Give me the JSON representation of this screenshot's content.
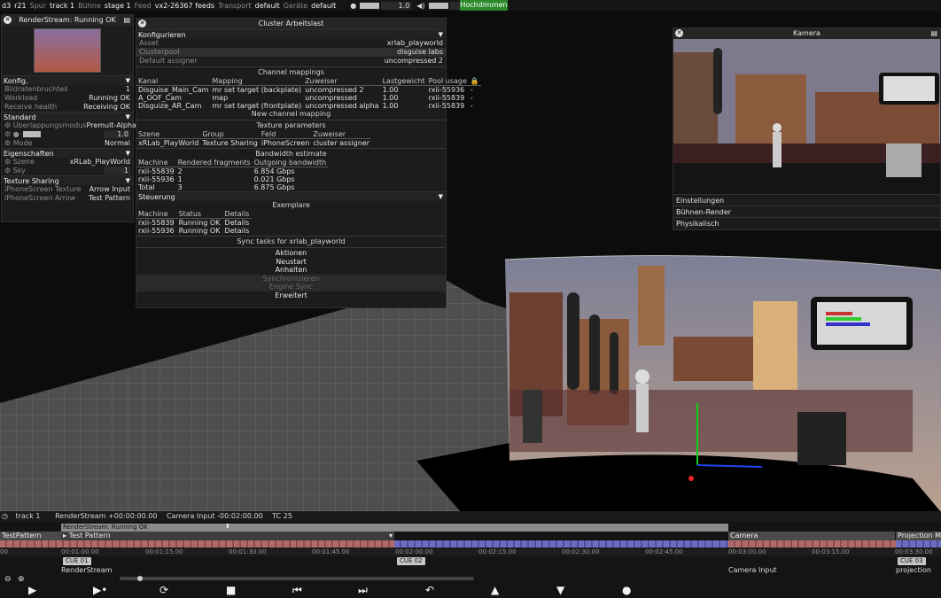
{
  "topbar": {
    "app": "d3",
    "ver": "r21",
    "spur_label": "Spur",
    "spur_value": "track 1",
    "buehne_label": "Bühne",
    "buehne_value": "stage 1",
    "feed_label": "Feed",
    "feed_value": "vx2-26367 feeds",
    "transport_label": "Transport",
    "transport_value": "default",
    "geraete_label": "Geräte",
    "geraete_value": "default",
    "brightness_value": "1.0",
    "volume_value": "1.0",
    "hoch_label": "Hochdimmen"
  },
  "left_panel": {
    "title": "RenderStream: Running OK",
    "konfig": {
      "label": "Konfig.",
      "rows": [
        {
          "k": "Bildratenbruchteil",
          "v": "1"
        },
        {
          "k": "Workload",
          "v": "Running OK"
        },
        {
          "k": "Receive health",
          "v": "Receiving OK"
        }
      ]
    },
    "standard": {
      "label": "Standard",
      "blend_k": "Überlappungsmodus",
      "blend_v": "Premult-Alpha",
      "bright_v": "1.0",
      "mode_k": "Mode",
      "mode_v": "Normal"
    },
    "eig": {
      "label": "Eigenschaften",
      "szene_k": "Szene",
      "szene_v": "xRLab_PlayWorld",
      "sky_k": "Sky",
      "sky_v": "1"
    },
    "tex": {
      "label": "Texture Sharing",
      "r1k": "iPhoneScreen Texture",
      "r1v": "Arrow Input",
      "r2k": "iPhoneScreen Arrow",
      "r2v": "Test Pattern"
    }
  },
  "cluster": {
    "title": "Cluster Arbeitslast",
    "konfig_label": "Konfigurieren",
    "rows": [
      {
        "k": "Asset",
        "v": "xrlab_playworld"
      },
      {
        "k": "Clusterpool",
        "v": "disguise labs"
      },
      {
        "k": "Default assigner",
        "v": "uncompressed 2"
      }
    ],
    "cm_title": "Channel mappings",
    "cm_head": [
      "Kanal",
      "Mapping",
      "Zuweiser",
      "Lastgewicht",
      "Pool usage"
    ],
    "cm_rows": [
      [
        "Disguise_Main_Cam",
        "mr set target (backplate)",
        "uncompressed 2",
        "1.00",
        "rxii-55936",
        "-"
      ],
      [
        "A_OOF_Cam",
        "map",
        "uncompressed",
        "1.00",
        "rxii-55839",
        "-"
      ],
      [
        "Disguize_AR_Cam",
        "mr set target (frontplate)",
        "uncompressed alpha",
        "1.00",
        "rxii-55839",
        "-"
      ]
    ],
    "new_mapping": "New channel mapping",
    "tp_title": "Texture parameters",
    "tp_head": [
      "Szene",
      "Group",
      "Feld",
      "Zuweiser"
    ],
    "tp_row": [
      "xRLab_PlayWorld",
      "Texture Sharing",
      "iPhoneScreen",
      "cluster assigner"
    ],
    "bw_title": "Bandwidth estimate",
    "bw_head": [
      "Machine",
      "Rendered fragments",
      "Outgoing bandwidth"
    ],
    "bw_rows": [
      [
        "rxii-55839",
        "2",
        "6.854 Gbps"
      ],
      [
        "rxii-55936",
        "1",
        "0.021 Gbps"
      ],
      [
        "Total",
        "3",
        "6.875 Gbps"
      ]
    ],
    "steuerung_label": "Steuerung",
    "ex_title": "Exemplare",
    "ex_head": [
      "Machine",
      "Status",
      "Details"
    ],
    "ex_rows": [
      [
        "rxii-55839",
        "Running OK",
        "Details"
      ],
      [
        "rxii-55936",
        "Running OK",
        "Details"
      ]
    ],
    "sync_title": "Sync tasks for xrlab_playworld",
    "buttons": [
      "Aktionen",
      "Neustart",
      "Anhalten",
      "Synchronisieren",
      "Engine Sync",
      "Erweitert"
    ]
  },
  "kamera": {
    "title": "Kamera",
    "items": [
      "Einstellungen",
      "Bühnen-Render",
      "Physikalisch"
    ]
  },
  "timeline": {
    "track": "track 1",
    "rs_info": "RenderStream +00:00:00.00",
    "cam_info": "Camera Input -00:02:00.00",
    "tc": "TC 25",
    "bar1": "RenderStream: Running OK",
    "l_testpattern": "TestPattern",
    "l_testpattern2": "Test Pattern",
    "l_camera": "Camera",
    "l_projection": "Projection Ma",
    "times": [
      "00:01:00.00",
      "00:01:15.00",
      "00:01:30.00",
      "00:01:45.00",
      "00:02:00.00",
      "00:02:15.00",
      "00:02:30.00",
      "00:02:45.00",
      "00:03:00.00",
      "00:03:15.00",
      "00:03:30.00"
    ],
    "cue1": "CUE 01",
    "cue2": "CUE 02",
    "cue3": "CUE 03",
    "sub1": "RenderStream",
    "sub2": "Camera Input",
    "sub3": "projection",
    "zero": "00"
  },
  "colors": {
    "accent_green": "#2b8a2b",
    "clip_red": "#b06a6a",
    "clip_blue": "#6c6cc4"
  }
}
